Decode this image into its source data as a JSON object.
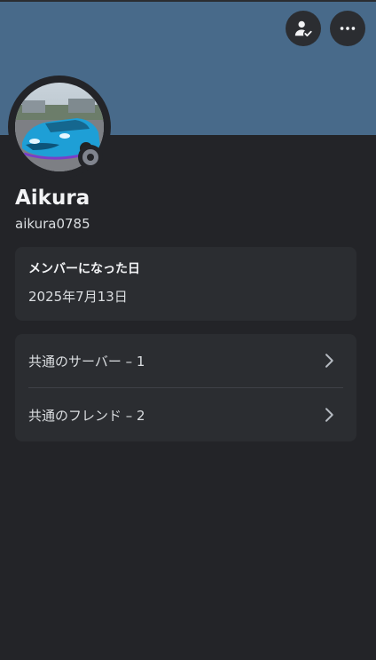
{
  "profile": {
    "display_name": "Aikura",
    "username": "aikura0785",
    "status": "offline"
  },
  "colors": {
    "banner": "#486a8a",
    "background": "#232428",
    "card": "#2b2d31",
    "status_offline": "#80848e"
  },
  "header": {
    "friend_icon": "friend-check-icon",
    "more_icon": "more-horizontal-icon"
  },
  "member_since": {
    "title": "メンバーになった日",
    "date": "2025年7月13日"
  },
  "mutual": {
    "servers_label": "共通のサーバー – 1",
    "friends_label": "共通のフレンド – 2"
  }
}
